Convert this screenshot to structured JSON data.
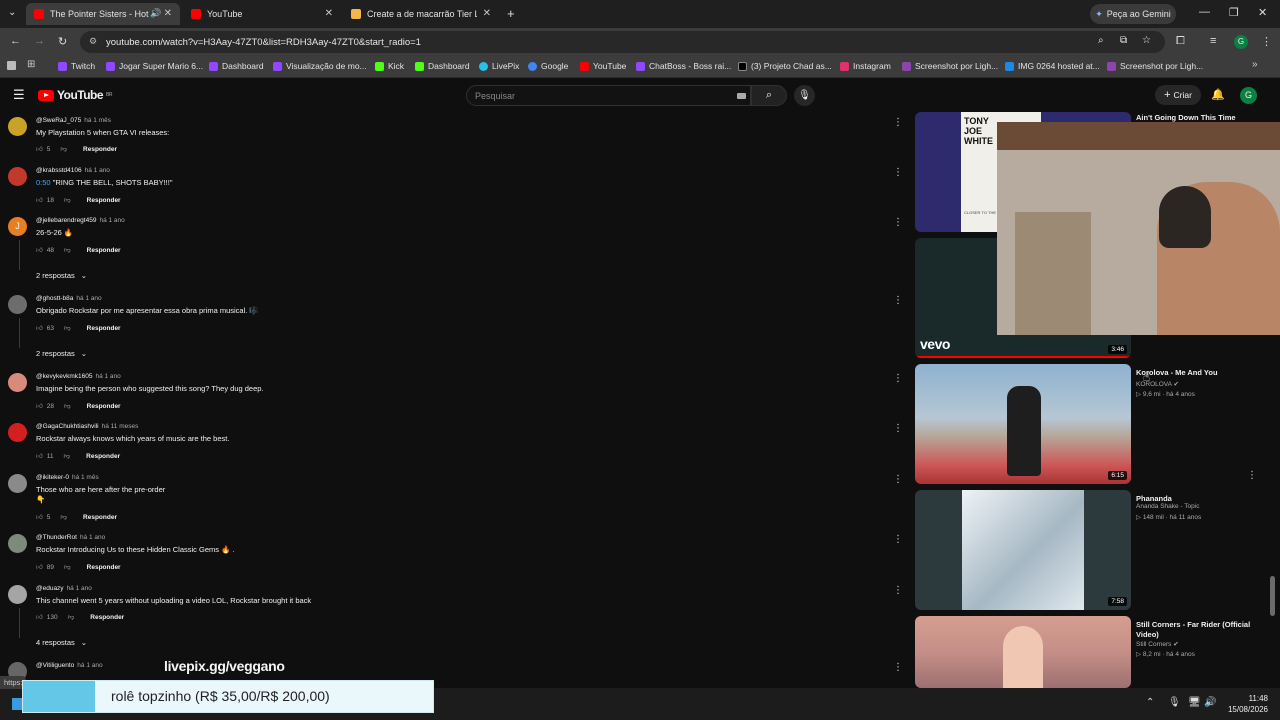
{
  "browser": {
    "tabs": [
      {
        "title": "The Pointer Sisters - Hot To",
        "favicon_color": "#ff0000"
      },
      {
        "title": "YouTube",
        "favicon_color": "#ff0000"
      },
      {
        "title": "Create a de macarrão Tier List",
        "favicon_color": "#f2b84b"
      }
    ],
    "gemini_label": "Peça ao Gemini",
    "url": "youtube.com/watch?v=H3Aay-47ZT0&list=RDH3Aay-47ZT0&start_radio=1",
    "bookmarks": [
      {
        "label": "Twitch",
        "color": "#9146ff"
      },
      {
        "label": "Jogar Super Mario 6...",
        "color": "#9146ff"
      },
      {
        "label": "Dashboard",
        "color": "#9146ff"
      },
      {
        "label": "Visualização de mo...",
        "color": "#9146ff"
      },
      {
        "label": "Kick",
        "color": "#53fc18"
      },
      {
        "label": "Dashboard",
        "color": "#53fc18"
      },
      {
        "label": "LivePix",
        "color": "#27c0e8"
      },
      {
        "label": "Google",
        "color": "#4285f4"
      },
      {
        "label": "YouTube",
        "color": "#ff0000"
      },
      {
        "label": "ChatBoss - Boss rai...",
        "color": "#9146ff"
      },
      {
        "label": "(3) Projeto Chad as...",
        "color": "#000000"
      },
      {
        "label": "Instagram",
        "color": "#e1306c"
      },
      {
        "label": "Screenshot por Ligh...",
        "color": "#8e44ad"
      },
      {
        "label": "IMG 0264 hosted at...",
        "color": "#1e88e5"
      },
      {
        "label": "Screenshot por Ligh...",
        "color": "#8e44ad"
      }
    ]
  },
  "youtube": {
    "logo_text": "YouTube",
    "logo_sup": "BR",
    "search_placeholder": "Pesquisar",
    "create_label": "Criar",
    "avatar_letter": "G"
  },
  "comments": [
    {
      "author": "@SweRaJ_075",
      "when": "há 1 mês",
      "text": "My Playstation 5 when GTA VI releases:",
      "likes": "5",
      "reply": "Responder",
      "avatar_color": "#c9a227"
    },
    {
      "author": "@krabsstd4106",
      "when": "há 1 ano",
      "timestamp": "0:50",
      "text": "\"RING THE BELL, SHOTS BABY!!!\"",
      "likes": "18",
      "reply": "Responder",
      "avatar_color": "#c0392b"
    },
    {
      "author": "@jellebarendregt459",
      "when": "há 1 ano",
      "text": "26-5-26 🔥",
      "likes": "48",
      "reply": "Responder",
      "avatar_color": "#e67e22",
      "avatar_letter": "J",
      "replies": "2 respostas"
    },
    {
      "author": "@ghostt-b8a",
      "when": "há 1 ano",
      "text": "Obrigado Rockstar por me apresentar essa obra prima musical. 🎼",
      "likes": "63",
      "reply": "Responder",
      "avatar_color": "#6d6d6d",
      "replies": "2 respostas"
    },
    {
      "author": "@kevykevkmk1605",
      "when": "há 1 ano",
      "text": "Imagine being the person who suggested this song? They dug deep.",
      "likes": "28",
      "reply": "Responder",
      "avatar_color": "#d98b7b"
    },
    {
      "author": "@GagaChukhtiashvili",
      "when": "há 11 meses",
      "text": "Rockstar always knows which years of music are the best.",
      "likes": "11",
      "reply": "Responder",
      "avatar_color": "#d31f1f"
    },
    {
      "author": "@ikiteker-0",
      "when": "há 1 mês",
      "text": "Those who are here after the pre-order",
      "text2": "👇",
      "likes": "5",
      "reply": "Responder",
      "avatar_color": "#8a8a8a"
    },
    {
      "author": "@ThunderRot",
      "when": "há 1 ano",
      "text": "Rockstar Introducing Us to these Hidden Classic Gems 🔥 .",
      "likes": "89",
      "reply": "Responder",
      "avatar_color": "#7d8c7a"
    },
    {
      "author": "@eduazy",
      "when": "há 1 ano",
      "text": "This channel went 5 years without uploading a video LOL, Rockstar brought it back",
      "likes": "130",
      "reply": "Responder",
      "avatar_color": "#a5a5a5",
      "replies": "4 respostas"
    },
    {
      "author": "@Vitiliguento",
      "when": "há 1 ano",
      "avatar_color": "#666666"
    }
  ],
  "sidebar": [
    {
      "title": "Ain't Going Down This Time",
      "thumb_text": "TONY JOE WHITE",
      "thumb_sub": "CLOSER TO THE",
      "duration": "",
      "channel": "",
      "meta": ""
    },
    {
      "title": "",
      "thumb_text": "vevo",
      "duration": "3:46",
      "channel": "",
      "meta": ""
    },
    {
      "title": "Korolova - Me And You",
      "channel": "KOROLOVA",
      "meta": "9,6 mi · há 4 anos",
      "duration": "6:15"
    },
    {
      "title": "Phananda",
      "channel": "Ananda Shake - Topic",
      "meta": "148 mil · há 11 anos",
      "duration": "7:58"
    },
    {
      "title": "Still Corners - Far Rider (Official Video)",
      "channel": "Still Corners",
      "meta": "8,2 mi · há 4 anos",
      "duration": ""
    }
  ],
  "overlay": {
    "livepix_text": "livepix.gg/veggano",
    "donation_text": "rolê topzinho (R$ 35,00/R$ 200,00)",
    "status_url": "https:"
  },
  "taskbar": {
    "time": "11:48",
    "date": "15/08/2026"
  }
}
